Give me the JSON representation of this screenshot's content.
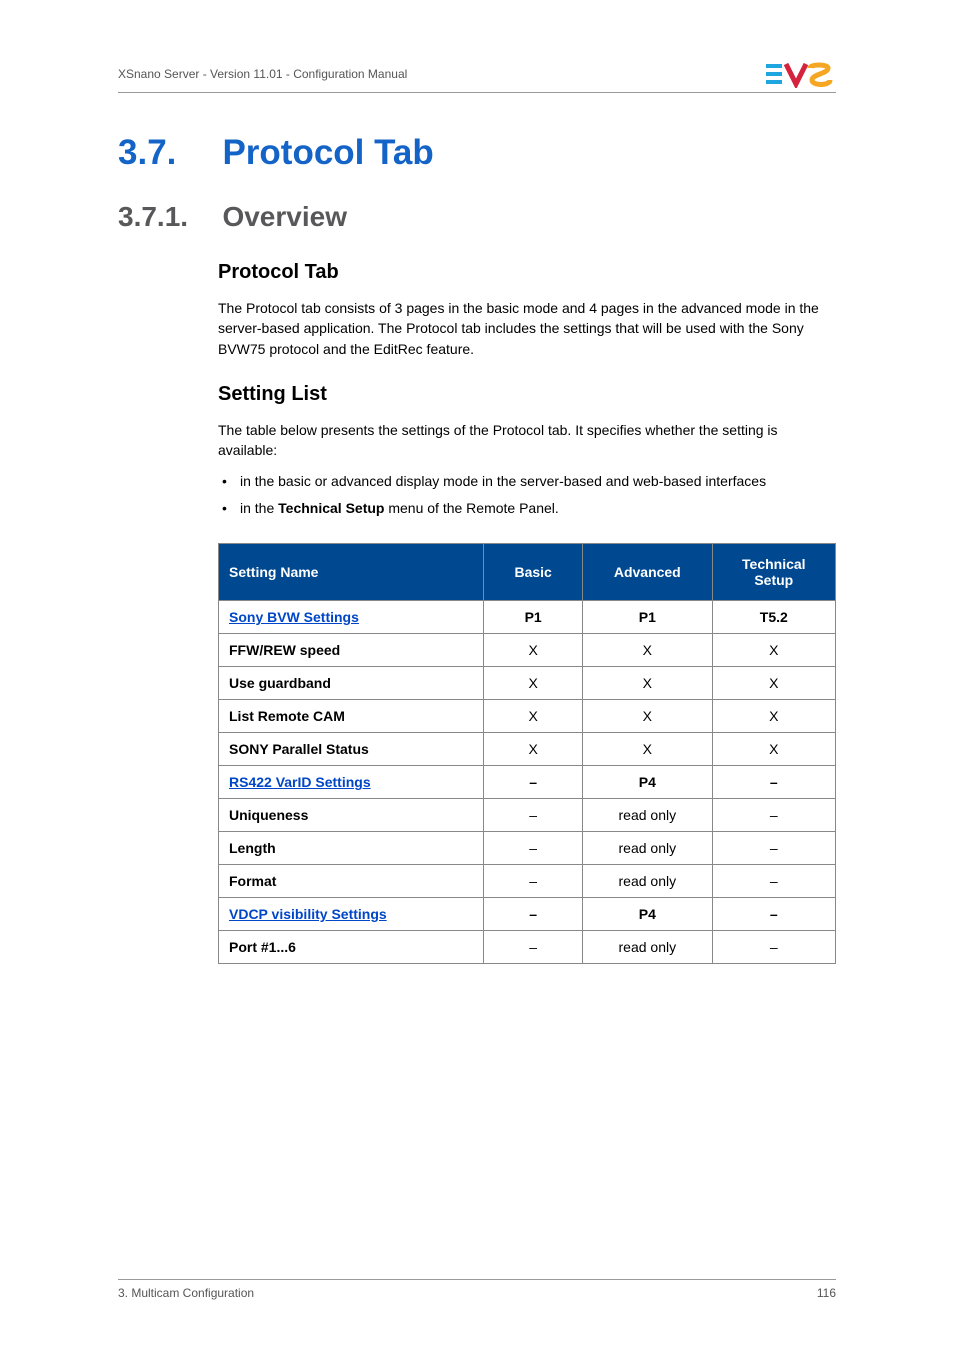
{
  "header": {
    "text": "XSnano Server - Version 11.01 - Configuration Manual"
  },
  "section": {
    "number": "3.7.",
    "title": "Protocol Tab"
  },
  "subsection": {
    "number": "3.7.1.",
    "title": "Overview"
  },
  "block1": {
    "heading": "Protocol Tab",
    "text": "The Protocol tab consists of 3 pages in the basic mode and 4 pages in the advanced mode in the server-based application. The Protocol tab includes the settings that will be used with the Sony BVW75 protocol and the EditRec feature."
  },
  "block2": {
    "heading": "Setting List",
    "intro": "The table below presents the settings of the Protocol tab. It specifies whether the setting is available:",
    "bullet1_a": "in the basic or advanced display mode in the server-based and web-based interfaces",
    "bullet2_a": "in the ",
    "bullet2_b": "Technical Setup",
    "bullet2_c": " menu of the Remote Panel."
  },
  "table": {
    "headers": {
      "name": "Setting Name",
      "basic": "Basic",
      "advanced": "Advanced",
      "tech_a": "Technical",
      "tech_b": "Setup"
    },
    "rows": [
      {
        "name": "Sony BVW Settings",
        "link": true,
        "bold_center": true,
        "basic": "P1",
        "advanced": "P1",
        "tech": "T5.2"
      },
      {
        "name": "FFW/REW speed",
        "link": false,
        "basic": "X",
        "advanced": "X",
        "tech": "X"
      },
      {
        "name": "Use guardband",
        "link": false,
        "basic": "X",
        "advanced": "X",
        "tech": "X"
      },
      {
        "name": "List Remote CAM",
        "link": false,
        "basic": "X",
        "advanced": "X",
        "tech": "X"
      },
      {
        "name": "SONY Parallel Status",
        "link": false,
        "basic": "X",
        "advanced": "X",
        "tech": "X"
      },
      {
        "name": "RS422 VarID Settings",
        "link": true,
        "bold_center": true,
        "basic": "–",
        "advanced": "P4",
        "tech": "–"
      },
      {
        "name": "Uniqueness",
        "link": false,
        "basic": "–",
        "advanced": "read only",
        "tech": "–"
      },
      {
        "name": "Length",
        "link": false,
        "basic": "–",
        "advanced": "read only",
        "tech": "–"
      },
      {
        "name": "Format",
        "link": false,
        "basic": "–",
        "advanced": "read only",
        "tech": "–"
      },
      {
        "name": "VDCP visibility Settings",
        "link": true,
        "bold_center": true,
        "basic": "–",
        "advanced": "P4",
        "tech": "–"
      },
      {
        "name": "Port #1...6",
        "link": false,
        "basic": "–",
        "advanced": "read only",
        "tech": "–"
      }
    ]
  },
  "footer": {
    "left": "3. Multicam Configuration",
    "right": "116"
  }
}
